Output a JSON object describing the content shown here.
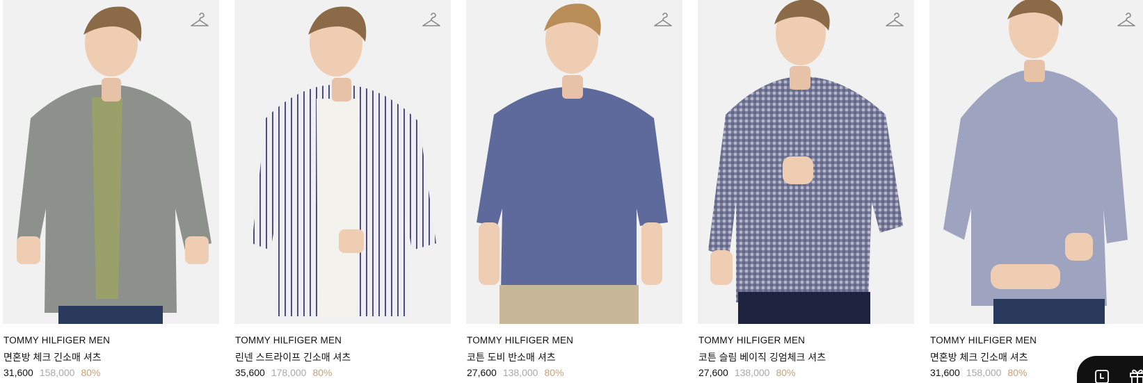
{
  "products": [
    {
      "brand": "TOMMY HILFIGER MEN",
      "name": "면혼방 체크 긴소매 셔츠",
      "sale_price": "31,600",
      "original_price": "158,000",
      "discount": "80%",
      "shirt_color": "#8d918c",
      "inner_color": "#9aa06a"
    },
    {
      "brand": "TOMMY HILFIGER MEN",
      "name": "린넨 스트라이프 긴소매 셔츠",
      "sale_price": "35,600",
      "original_price": "178,000",
      "discount": "80%",
      "shirt_color": "#e9e9ef",
      "inner_color": "#f4f2ec"
    },
    {
      "brand": "TOMMY HILFIGER MEN",
      "name": "코튼 도비 반소매 셔츠",
      "sale_price": "27,600",
      "original_price": "138,000",
      "discount": "80%",
      "shirt_color": "#5f6a9c",
      "inner_color": "#5f6a9c"
    },
    {
      "brand": "TOMMY HILFIGER MEN",
      "name": "코튼 슬림 베이직 깅엄체크 셔츠",
      "sale_price": "27,600",
      "original_price": "138,000",
      "discount": "80%",
      "shirt_color": "#6d7190",
      "inner_color": "#6d7190"
    },
    {
      "brand": "TOMMY HILFIGER MEN",
      "name": "면혼방 체크 긴소매 셔츠",
      "sale_price": "31,600",
      "original_price": "158,000",
      "discount": "80%",
      "shirt_color": "#9ea4bf",
      "inner_color": "#9ea4bf"
    }
  ],
  "icons": {
    "wishlist": "hanger-icon",
    "recent": "clock-icon",
    "gift": "gift-icon"
  },
  "colors": {
    "discount": "#c8a07a",
    "original_price": "#a9a9a9",
    "photo_background": "#f1f1f1"
  }
}
